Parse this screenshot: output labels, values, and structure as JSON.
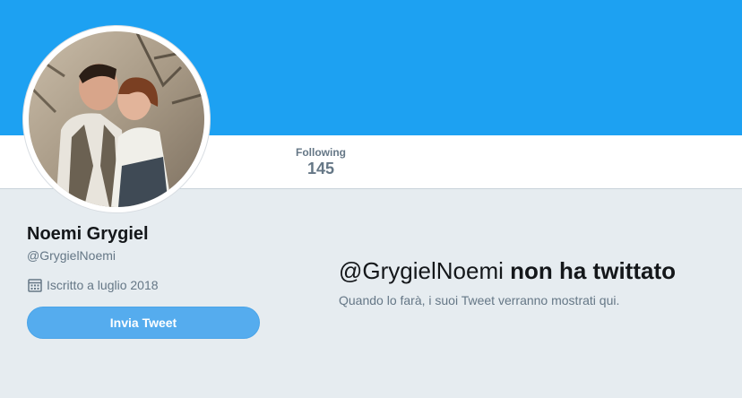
{
  "colors": {
    "banner": "#1da1f2",
    "page_background": "#e6ecf0",
    "button": "#55acee",
    "muted_text": "#657786"
  },
  "stats": {
    "following": {
      "label": "Following",
      "value": "145"
    }
  },
  "profile": {
    "avatar_icon": "profile-photo",
    "name": "Noemi Grygiel",
    "handle": "@GrygielNoemi",
    "joined_icon": "calendar-icon",
    "joined": "Iscritto a luglio 2018",
    "tweet_button": "Invia Tweet"
  },
  "empty_state": {
    "title_handle": "@GrygielNoemi",
    "title_rest": "non ha twittato",
    "subtitle": "Quando lo farà, i suoi Tweet verranno mostrati qui."
  }
}
